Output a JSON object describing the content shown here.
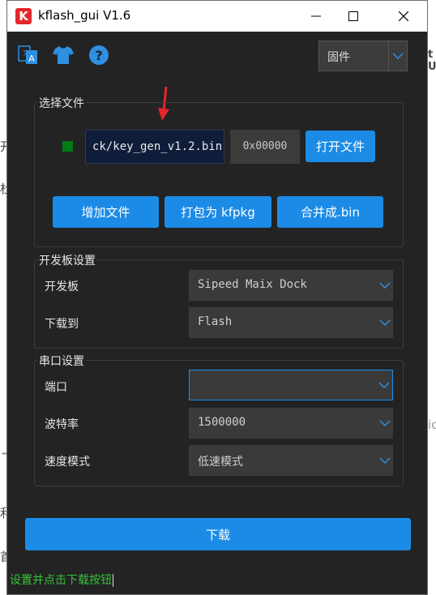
{
  "window": {
    "title": "kflash_gui V1.6",
    "app_icon_letter": "K",
    "controls": [
      "minimize",
      "maximize",
      "close"
    ]
  },
  "toolbar": {
    "icons": [
      "language-icon",
      "skin-icon",
      "help-icon"
    ],
    "firmware_select": "固件"
  },
  "file_group": {
    "legend": "选择文件",
    "file_path": "ck/key_gen_v1.2.bin",
    "address": "0x00000",
    "open_button": "打开文件",
    "add_button": "增加文件",
    "pack_button": "打包为 kfpkg",
    "merge_button": "合并成.bin",
    "status_color": "#007a11"
  },
  "board_group": {
    "legend": "开发板设置",
    "board_label": "开发板",
    "board_value": "Sipeed Maix Dock",
    "download_to_label": "下载到",
    "download_to_value": "Flash"
  },
  "serial_group": {
    "legend": "串口设置",
    "port_label": "端口",
    "port_value": "",
    "baud_label": "波特率",
    "baud_value": "1500000",
    "speed_label": "速度模式",
    "speed_value": "低速模式"
  },
  "download_button": "下载",
  "status_text": "设置并点击下载按钮",
  "colors": {
    "accent": "#1b8be6",
    "background": "#232323",
    "status_text": "#36c23a"
  },
  "background_fragments": {
    "left_top": "开",
    "left_mid": "杜",
    "left_plus": "+",
    "left_bottom1": "利",
    "left_bottom2": "首",
    "right_top": "t U",
    "right_mid": "ic"
  }
}
